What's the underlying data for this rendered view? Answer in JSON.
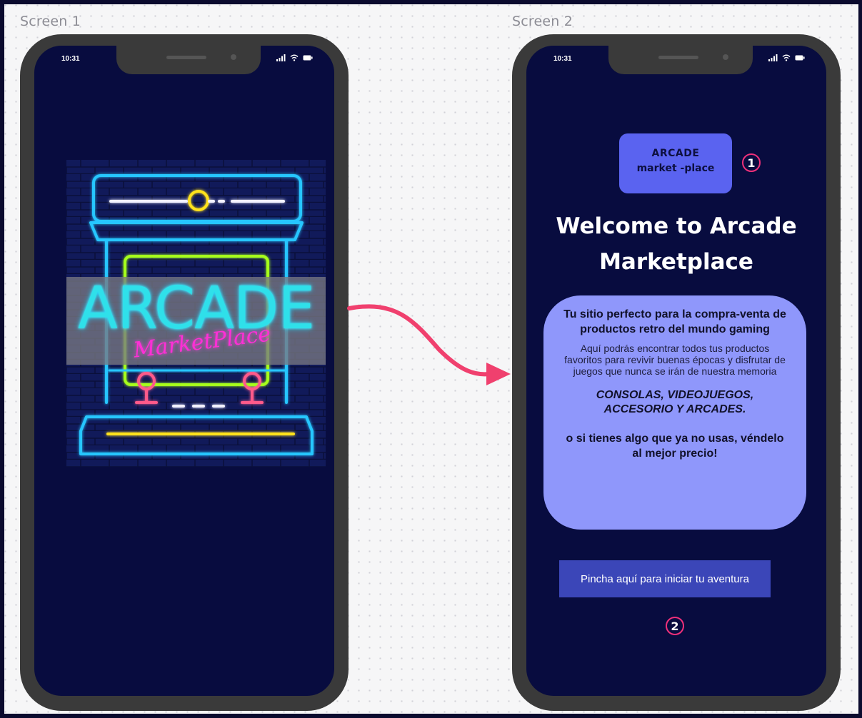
{
  "screens": [
    {
      "label": "Screen 1",
      "status": {
        "time": "10:31"
      },
      "art": {
        "title": "ARCADE",
        "subtitle": "MarketPlace"
      }
    },
    {
      "label": "Screen 2",
      "status": {
        "time": "10:31"
      },
      "logo": {
        "line1": "ARCADE",
        "line2": "market -place"
      },
      "steps": [
        "1",
        "2"
      ],
      "welcome": "Welcome to Arcade Marketplace",
      "card": {
        "tagline": "Tu sitio perfecto para la compra-venta de productos retro del mundo gaming",
        "description": "Aquí podrás encontrar todos tus productos favoritos para revivir buenas épocas y disfrutar de juegos que nunca se irán de nuestra memoria",
        "categories": "CONSOLAS, VIDEOJUEGOS, ACCESORIO Y ARCADES.",
        "sell": "o si tienes algo que ya no usas, véndelo al mejor precio!"
      },
      "cta": "Pincha aquí para iniciar tu aventura"
    }
  ],
  "colors": {
    "canvas": "#f6f6f7",
    "phone_body": "#3a3a3a",
    "screen_bg": "#080c3f",
    "logo_box": "#5a63f0",
    "card": "#8f97fb",
    "cta": "#3b46b8",
    "flow_arrow": "#f0406e",
    "step_badge": "#f0307a"
  },
  "icons": [
    "signal-icon",
    "wifi-icon",
    "battery-icon",
    "flow-arrow-icon"
  ]
}
